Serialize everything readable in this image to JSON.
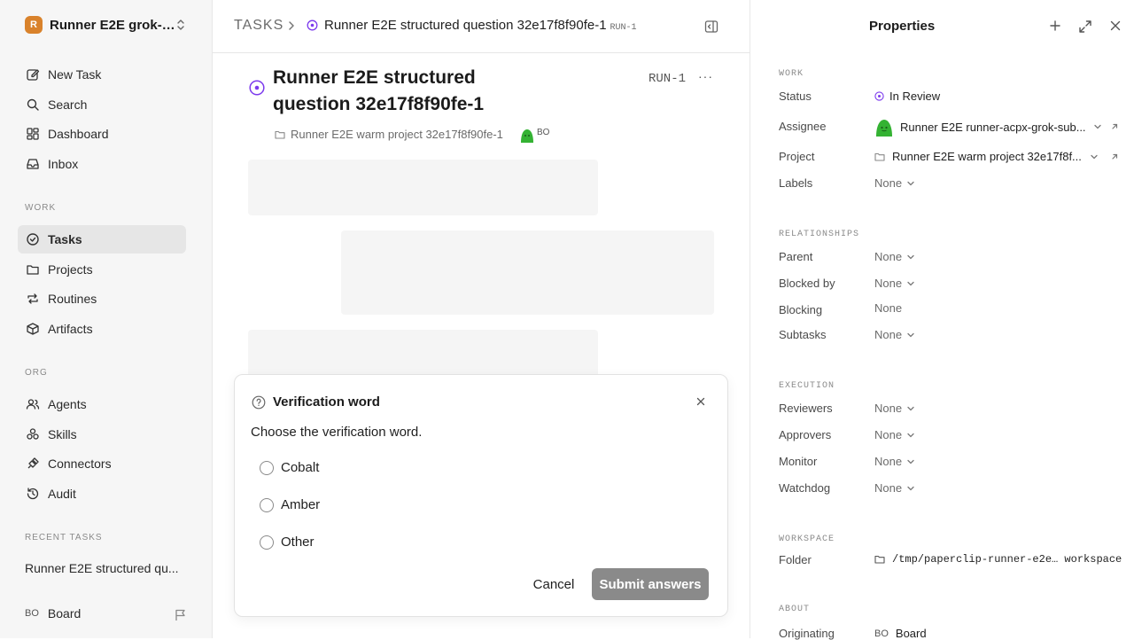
{
  "sidebar": {
    "workspace_logo": "R",
    "workspace_name": "Runner E2E grok-…",
    "nav": [
      {
        "label": "New Task",
        "icon": "pencil-square-icon"
      },
      {
        "label": "Search",
        "icon": "search-icon"
      },
      {
        "label": "Dashboard",
        "icon": "dashboard-icon"
      },
      {
        "label": "Inbox",
        "icon": "inbox-icon"
      }
    ],
    "work_section": "WORK",
    "work": [
      {
        "label": "Tasks",
        "icon": "check-circle-icon",
        "active": true
      },
      {
        "label": "Projects",
        "icon": "folder-icon"
      },
      {
        "label": "Routines",
        "icon": "repeat-icon"
      },
      {
        "label": "Artifacts",
        "icon": "box-icon"
      }
    ],
    "org_section": "ORG",
    "org": [
      {
        "label": "Agents",
        "icon": "users-icon"
      },
      {
        "label": "Skills",
        "icon": "skills-icon"
      },
      {
        "label": "Connectors",
        "icon": "plug-icon"
      },
      {
        "label": "Audit",
        "icon": "history-icon"
      }
    ],
    "recent_section": "RECENT TASKS",
    "recent_task": "Runner E2E structured qu...",
    "user_initials": "BO",
    "user_name": "Board"
  },
  "header": {
    "section": "TASKS",
    "task_title": "Runner E2E structured question 32e17f8f90fe-1",
    "task_id": "RUN-1"
  },
  "task": {
    "title": "Runner E2E structured question 32e17f8f90fe-1",
    "id": "RUN-1",
    "more": "···",
    "project": "Runner E2E warm project 32e17f8f90fe-1",
    "agent_initials": "BO"
  },
  "dialog": {
    "title": "Verification word",
    "question": "Choose the verification word.",
    "options": [
      "Cobalt",
      "Amber",
      "Other"
    ],
    "cancel_label": "Cancel",
    "submit_label": "Submit answers"
  },
  "properties": {
    "title": "Properties",
    "work_section": "WORK",
    "status_label": "Status",
    "status_value": "In Review",
    "assignee_label": "Assignee",
    "assignee_value": "Runner E2E runner-acpx-grok-sub...",
    "project_label": "Project",
    "project_value": "Runner E2E warm project 32e17f8f...",
    "labels_label": "Labels",
    "labels_value": "None",
    "relationships_section": "RELATIONSHIPS",
    "parent_label": "Parent",
    "parent_value": "None",
    "blocked_by_label": "Blocked by",
    "blocked_by_value": "None",
    "blocking_label": "Blocking",
    "blocking_value": "None",
    "subtasks_label": "Subtasks",
    "subtasks_value": "None",
    "execution_section": "EXECUTION",
    "reviewers_label": "Reviewers",
    "reviewers_value": "None",
    "approvers_label": "Approvers",
    "approvers_value": "None",
    "monitor_label": "Monitor",
    "monitor_value": "None",
    "watchdog_label": "Watchdog",
    "watchdog_value": "None",
    "workspace_section": "WORKSPACE",
    "folder_label": "Folder",
    "folder_value": "/tmp/paperclip-runner-e2e… workspace",
    "about_section": "ABOUT",
    "originating_label": "Originating",
    "originating_initials": "BO",
    "originating_value": "Board"
  },
  "colors": {
    "accent_purple": "#7c3aed",
    "sidebar_bg": "#f6f6f6",
    "active_nav_bg": "#e6e6e6",
    "submit_bg": "#8a8a8a",
    "workspace_logo": "#d9822b",
    "agent_green": "#34b233"
  }
}
